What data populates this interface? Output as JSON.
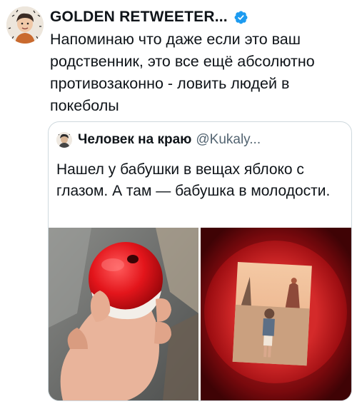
{
  "tweet": {
    "author_name": "GOLDEN RETWEETER...",
    "text": "Напоминаю что даже если это ваш родственник, это все ещё абсолютно противозаконно - ловить людей в покеболы"
  },
  "quoted_tweet": {
    "author_name": "Человек на краю",
    "handle": "@Kukaly...",
    "text": "Нашел у бабушки в вещах яблоко с глазом. А там — бабушка в молодости."
  },
  "icons": {
    "verified": "verified-badge-icon"
  },
  "colors": {
    "verified_blue": "#1d9bf0",
    "text_primary": "#0f1419",
    "text_secondary": "#536471",
    "border": "#cfd9de"
  }
}
